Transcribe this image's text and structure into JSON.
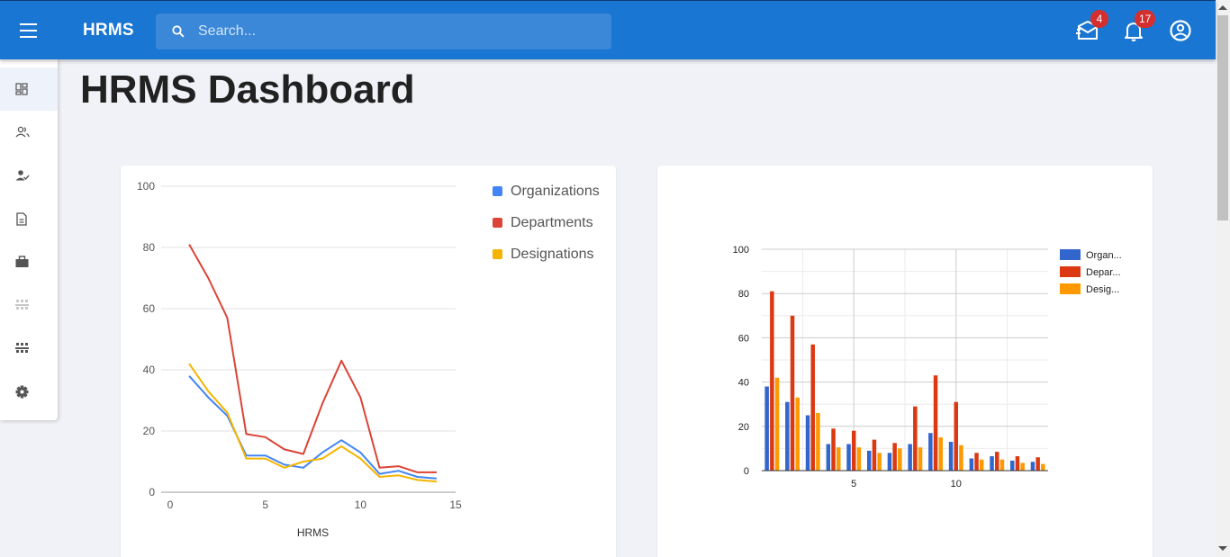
{
  "app": {
    "brand": "HRMS"
  },
  "search": {
    "placeholder": "Search..."
  },
  "topbar": {
    "mail_icon": "mail-icon",
    "mail_badge": "4",
    "bell_icon": "bell-icon",
    "bell_badge": "17",
    "account_icon": "account-circle-icon"
  },
  "sidebar": {
    "items": [
      {
        "icon": "dashboard-icon",
        "active": true
      },
      {
        "icon": "people-icon"
      },
      {
        "icon": "person-check-icon"
      },
      {
        "icon": "document-icon"
      },
      {
        "icon": "briefcase-icon"
      },
      {
        "icon": "org-chart-icon",
        "muted": true
      },
      {
        "icon": "org-chart-icon"
      },
      {
        "icon": "settings-icon"
      }
    ]
  },
  "page": {
    "title": "HRMS Dashboard"
  },
  "colors": {
    "primary": "#1976d2",
    "badge": "#d32f2f",
    "line_series": [
      "#4285f4",
      "#db4437",
      "#f4b400"
    ],
    "bar_series": [
      "#3366cc",
      "#dc3912",
      "#ff9900"
    ]
  },
  "chart_data": [
    {
      "type": "line",
      "xlabel": "HRMS",
      "ylabel": "",
      "xlim": [
        0,
        15
      ],
      "ylim": [
        0,
        100
      ],
      "xticks": [
        "0",
        "5",
        "10",
        "15"
      ],
      "yticks": [
        "0",
        "20",
        "40",
        "60",
        "80",
        "100"
      ],
      "grid": true,
      "legend_position": "right",
      "x": [
        1,
        2,
        3,
        4,
        5,
        6,
        7,
        8,
        9,
        10,
        11,
        12,
        13,
        14
      ],
      "series": [
        {
          "name": "Organizations",
          "values": [
            38,
            31,
            25,
            12,
            12,
            9,
            8,
            13,
            17,
            13,
            6,
            7,
            5,
            4.5
          ]
        },
        {
          "name": "Departments",
          "values": [
            81,
            70,
            57,
            19,
            18,
            14,
            12.5,
            29,
            43,
            31,
            8,
            8.5,
            6.5,
            6.5
          ]
        },
        {
          "name": "Designations",
          "values": [
            42,
            33,
            26,
            11,
            11,
            8,
            10,
            11,
            15,
            11,
            5,
            5.5,
            4,
            3.5
          ]
        }
      ]
    },
    {
      "type": "bar",
      "xlim": [
        0.5,
        14.5
      ],
      "ylim": [
        0,
        100
      ],
      "xticks": [
        "5",
        "10"
      ],
      "yticks": [
        "0",
        "20",
        "40",
        "60",
        "80",
        "100"
      ],
      "grid": true,
      "legend_position": "right",
      "x": [
        1,
        2,
        3,
        4,
        5,
        6,
        7,
        8,
        9,
        10,
        11,
        12,
        13,
        14
      ],
      "series": [
        {
          "name": "Organ...",
          "values": [
            38,
            31,
            25,
            12,
            12,
            9,
            8,
            12,
            17,
            13,
            5.5,
            6.5,
            4.5,
            4
          ]
        },
        {
          "name": "Depar...",
          "values": [
            81,
            70,
            57,
            19,
            18,
            14,
            12.5,
            29,
            43,
            31,
            8,
            8.5,
            6.5,
            6
          ]
        },
        {
          "name": "Desig...",
          "values": [
            42,
            33,
            26,
            10.5,
            10.5,
            8,
            10,
            10.5,
            15,
            11.5,
            5,
            5,
            3.5,
            3
          ]
        }
      ]
    }
  ]
}
